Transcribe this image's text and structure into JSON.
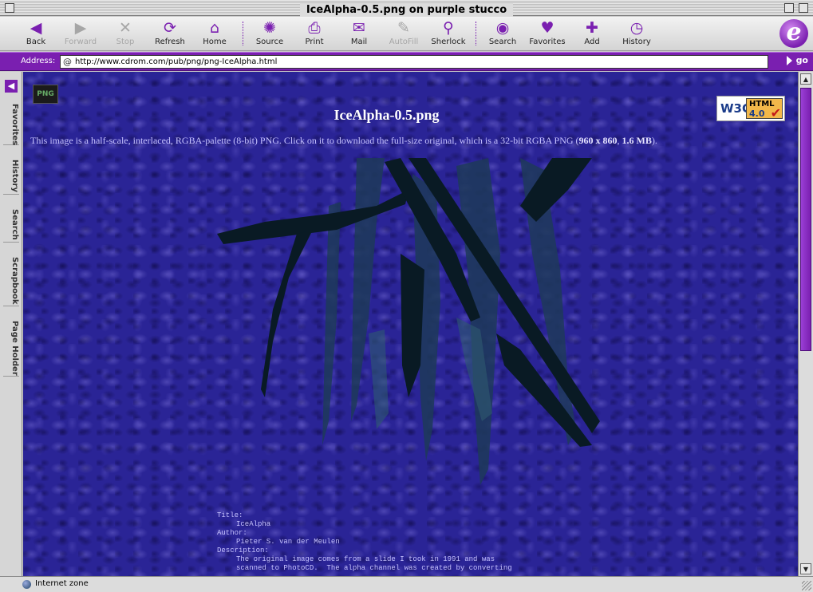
{
  "window": {
    "title": "IceAlpha-0.5.png on purple stucco"
  },
  "toolbar": {
    "buttons": [
      {
        "label": "Back",
        "icon": "◀",
        "enabled": true
      },
      {
        "label": "Forward",
        "icon": "▶",
        "enabled": false
      },
      {
        "label": "Stop",
        "icon": "✕",
        "enabled": false
      },
      {
        "label": "Refresh",
        "icon": "⟳",
        "enabled": true
      },
      {
        "label": "Home",
        "icon": "⌂",
        "enabled": true
      },
      {
        "label": "Source",
        "icon": "✺",
        "enabled": true
      },
      {
        "label": "Print",
        "icon": "⎙",
        "enabled": true
      },
      {
        "label": "Mail",
        "icon": "✉",
        "enabled": true
      },
      {
        "label": "AutoFill",
        "icon": "✎",
        "enabled": false
      },
      {
        "label": "Sherlock",
        "icon": "⚲",
        "enabled": true
      },
      {
        "label": "Search",
        "icon": "◉",
        "enabled": true
      },
      {
        "label": "Favorites",
        "icon": "♥",
        "enabled": true
      },
      {
        "label": "Add",
        "icon": "✚",
        "enabled": true
      },
      {
        "label": "History",
        "icon": "◷",
        "enabled": true
      }
    ],
    "logo_letter": "e"
  },
  "address": {
    "label": "Address:",
    "at_symbol": "@",
    "url": "http://www.cdrom.com/pub/png/png-IceAlpha.html",
    "go_label": "go"
  },
  "sidebar": {
    "tabs": [
      "Favorites",
      "History",
      "Search",
      "Scrapbook",
      "Page Holder"
    ]
  },
  "page": {
    "logo_text": "PNG",
    "badge": {
      "w3c": "W3C",
      "html": "HTML",
      "version": "4.0",
      "check": "✔"
    },
    "heading": "IceAlpha-0.5.png",
    "intro_before": "This image is a half-scale, interlaced, RGBA-palette (8-bit) PNG. Click on it to download the full-size original, which is a 32-bit RGBA PNG (",
    "intro_dims": "960 x 860",
    "intro_sep": ", ",
    "intro_size": "1.6 MB",
    "intro_after": ").",
    "meta": [
      {
        "key": "Title:",
        "value": "IceAlpha"
      },
      {
        "key": "Author:",
        "value": "Pieter S. van der Meulen"
      },
      {
        "key": "Description:",
        "value": "The original image comes from a slide I took in 1991 and was\nscanned to PhotoCD.  The alpha channel was created by converting"
      }
    ]
  },
  "status": {
    "zone": "Internet zone"
  },
  "colors": {
    "accent": "#7a1fb0",
    "background": "#2a2496",
    "text": "#c6c2ff"
  }
}
